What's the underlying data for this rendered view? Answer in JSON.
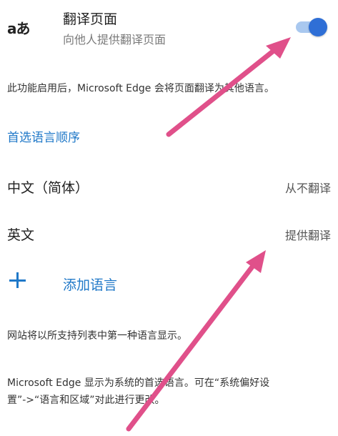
{
  "translate": {
    "icon_text": "aあ",
    "title": "翻译页面",
    "subtitle": "向他人提供翻译页面",
    "enabled": true
  },
  "description_1": "此功能启用后，Microsoft Edge 会将页面翻译为其他语言。",
  "preferred_languages_link": "首选语言顺序",
  "languages": [
    {
      "name": "中文（简体）",
      "status": "从不翻译"
    },
    {
      "name": "英文",
      "status": "提供翻译"
    }
  ],
  "add_language_label": "添加语言",
  "description_2": "网站将以所支持列表中第一种语言显示。",
  "description_3_line1": "Microsoft Edge 显示为系统的首选语言。可在“系统偏好设",
  "description_3_line2": "置”->“语言和区域”对此进行更改。",
  "colors": {
    "accent": "#1f78c8",
    "toggle_on": "#2f6fd6",
    "annotation_arrow": "#e0508a"
  }
}
